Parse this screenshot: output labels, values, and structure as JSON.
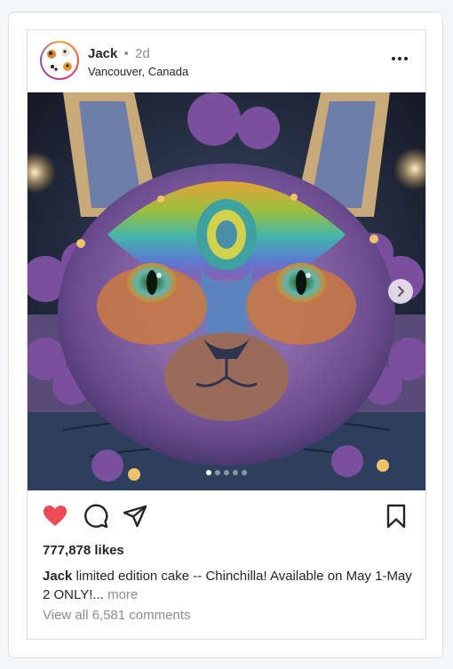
{
  "post": {
    "username": "Jack",
    "separator": "•",
    "time_ago": "2d",
    "location": "Vancouver, Canada",
    "likes": "777,878 likes",
    "caption_user": "Jack",
    "caption_text": "limited edition cake -- Chinchilla!  Available on May 1-May 2 ONLY!...",
    "caption_more": "more",
    "view_comments": "View all 6,581 comments",
    "carousel_count": 5,
    "carousel_active": 1,
    "liked": true
  },
  "icons": {
    "more": "more-horizontal-icon",
    "heart": "heart-icon",
    "comment": "comment-icon",
    "share": "send-icon",
    "save": "bookmark-icon",
    "next": "chevron-right-icon"
  },
  "colors": {
    "like_red": "#ed4956",
    "text": "#262626",
    "muted": "#8e8e8e",
    "border": "#dbdbdb"
  }
}
